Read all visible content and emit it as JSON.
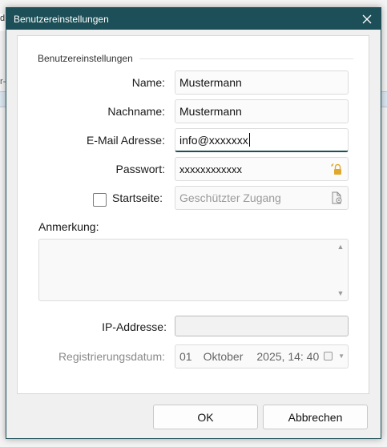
{
  "background": {
    "strip1_text": "d",
    "strip2_text": "r-"
  },
  "dialog": {
    "title": "Benutzereinstellungen",
    "close_label": "✕"
  },
  "group": {
    "title": "Benutzereinstellungen"
  },
  "fields": {
    "name_label": "Name:",
    "name_value": "Mustermann",
    "nachname_label": "Nachname:",
    "nachname_value": "Mustermann",
    "email_label": "E-Mail Adresse:",
    "email_value": "info@xxxxxxx",
    "passwort_label": "Passwort:",
    "passwort_value": "xxxxxxxxxxxx",
    "startseite_label": "Startseite:",
    "startseite_placeholder": "Geschützter Zugang",
    "startseite_checked": false,
    "anmerkung_label": "Anmerkung:",
    "anmerkung_value": "",
    "ip_label": "IP-Addresse:",
    "ip_value": "",
    "reg_label": "Registrierungsdatum:",
    "reg_day": "01",
    "reg_month": "Oktober",
    "reg_year_time": "2025, 14: 40"
  },
  "buttons": {
    "ok_label": "OK",
    "cancel_label": "Abbrechen"
  },
  "colors": {
    "titlebar": "#1c4f57",
    "accent_lock": "#e0a92c"
  }
}
